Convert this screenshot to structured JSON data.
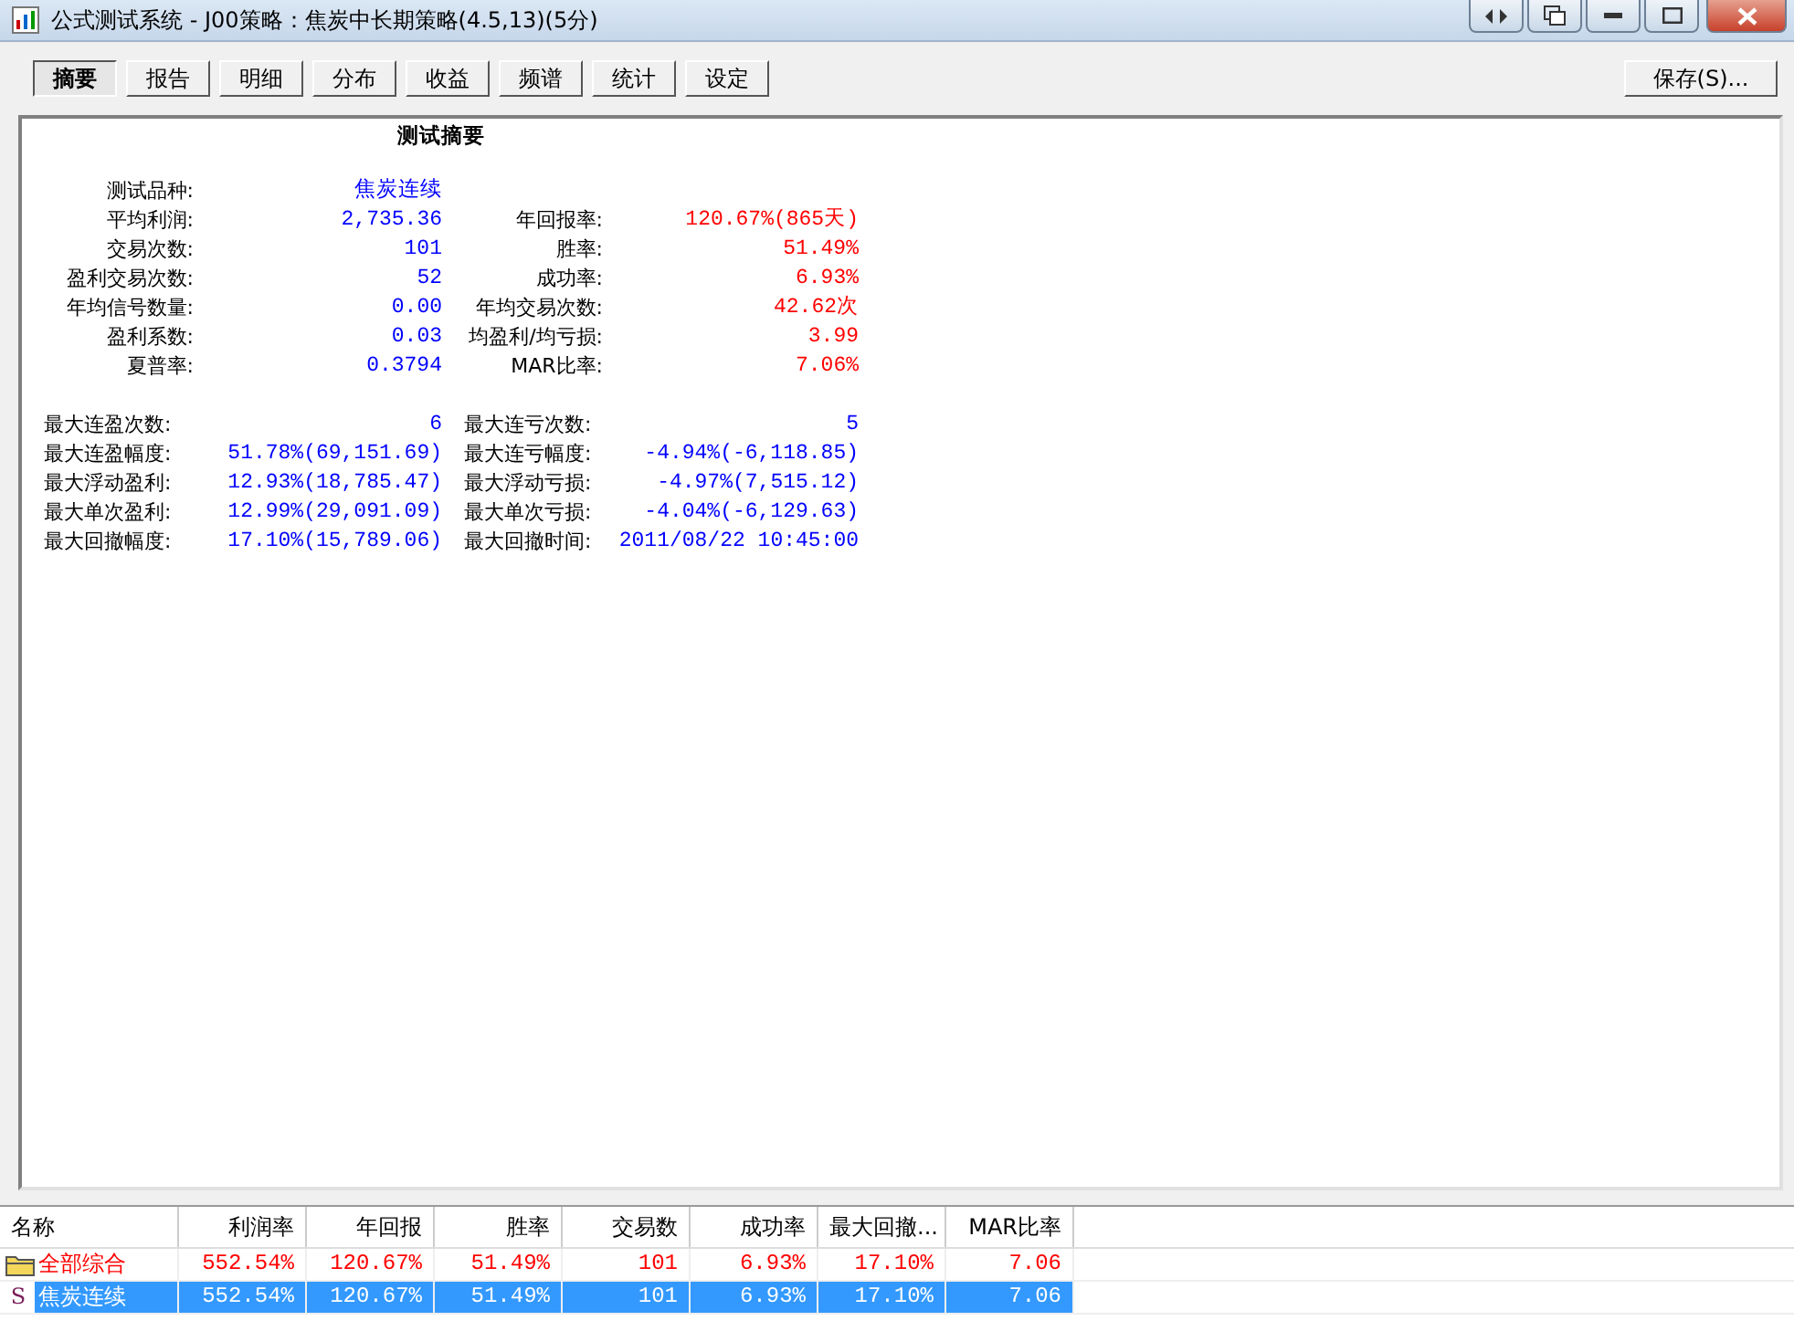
{
  "window": {
    "title": "公式测试系统 - J00策略：焦炭中长期策略(4.5,13)(5分)"
  },
  "tabs": [
    {
      "label": "摘要",
      "selected": true
    },
    {
      "label": "报告",
      "selected": false
    },
    {
      "label": "明细",
      "selected": false
    },
    {
      "label": "分布",
      "selected": false
    },
    {
      "label": "收益",
      "selected": false
    },
    {
      "label": "频谱",
      "selected": false
    },
    {
      "label": "统计",
      "selected": false
    },
    {
      "label": "设定",
      "selected": false
    }
  ],
  "save_button": "保存(S)...",
  "report": {
    "title": "测试摘要",
    "blocks": [
      {
        "kind": "summary",
        "rows": [
          {
            "left": {
              "label": "测试品种:",
              "value": "焦炭连续",
              "color": "#0000ff"
            }
          },
          {
            "left": {
              "label": "平均利润:",
              "value": "2,735.36",
              "color": "#0000ff"
            },
            "right": {
              "label": "年回报率:",
              "value": "120.67%(865天)",
              "color": "#ff0000"
            }
          },
          {
            "left": {
              "label": "交易次数:",
              "value": "101",
              "color": "#0000ff"
            },
            "right": {
              "label": "胜率:",
              "value": "51.49%",
              "color": "#ff0000"
            }
          },
          {
            "left": {
              "label": "盈利交易次数:",
              "value": "52",
              "color": "#0000ff"
            },
            "right": {
              "label": "成功率:",
              "value": "6.93%",
              "color": "#ff0000"
            }
          },
          {
            "left": {
              "label": "年均信号数量:",
              "value": "0.00",
              "color": "#0000ff"
            },
            "right": {
              "label": "年均交易次数:",
              "value": "42.62次",
              "color": "#ff0000"
            }
          },
          {
            "left": {
              "label": "盈利系数:",
              "value": "0.03",
              "color": "#0000ff"
            },
            "right": {
              "label": "均盈利/均亏损:",
              "value": "3.99",
              "color": "#ff0000"
            }
          },
          {
            "left": {
              "label": "夏普率:",
              "value": "0.3794",
              "color": "#0000ff"
            },
            "right": {
              "label": "MAR比率:",
              "value": "7.06%",
              "color": "#ff0000"
            }
          }
        ]
      },
      {
        "kind": "extremes",
        "rows": [
          {
            "left": {
              "label": "最大连盈次数:",
              "value": "6",
              "color": "#0000ff"
            },
            "right": {
              "label": "最大连亏次数:",
              "value": "5",
              "color": "#0000ff"
            }
          },
          {
            "left": {
              "label": "最大连盈幅度:",
              "value": "51.78%(69,151.69)",
              "color": "#0000ff"
            },
            "right": {
              "label": "最大连亏幅度:",
              "value": "-4.94%(-6,118.85)",
              "color": "#0000ff"
            }
          },
          {
            "left": {
              "label": "最大浮动盈利:",
              "value": "12.93%(18,785.47)",
              "color": "#0000ff"
            },
            "right": {
              "label": "最大浮动亏损:",
              "value": "-4.97%(7,515.12)",
              "color": "#0000ff"
            }
          },
          {
            "left": {
              "label": "最大单次盈利:",
              "value": "12.99%(29,091.09)",
              "color": "#0000ff"
            },
            "right": {
              "label": "最大单次亏损:",
              "value": "-4.04%(-6,129.63)",
              "color": "#0000ff"
            }
          },
          {
            "left": {
              "label": "最大回撤幅度:",
              "value": "17.10%(15,789.06)",
              "color": "#0000ff"
            },
            "right": {
              "label": "最大回撤时间:",
              "value": "2011/08/22 10:45:00",
              "color": "#0000ff"
            }
          }
        ]
      }
    ]
  },
  "table": {
    "columns": [
      "名称",
      "利润率",
      "年回报",
      "胜率",
      "交易数",
      "成功率",
      "最大回撤...",
      "MAR比率"
    ],
    "rows": [
      {
        "kind": "group",
        "selected": false,
        "cells": [
          "全部综合",
          "552.54%",
          "120.67%",
          "51.49%",
          "101",
          "6.93%",
          "17.10%",
          "7.06"
        ]
      },
      {
        "kind": "symbol",
        "marker": "S",
        "selected": true,
        "cells": [
          "焦炭连续",
          "552.54%",
          "120.67%",
          "51.49%",
          "101",
          "6.93%",
          "17.10%",
          "7.06"
        ]
      }
    ]
  }
}
